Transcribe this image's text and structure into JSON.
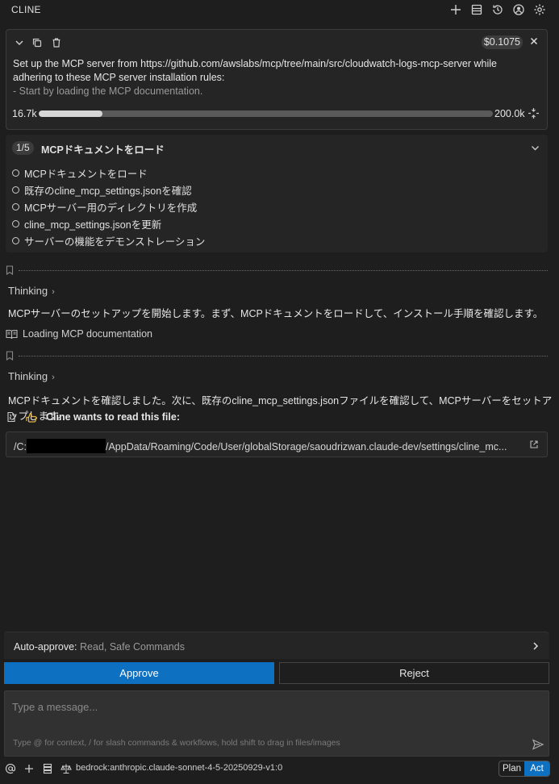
{
  "header": {
    "title": "CLINE"
  },
  "task": {
    "cost": "$0.1075",
    "text_line1": "Set up the MCP server from https://github.com/awslabs/mcp/tree/main/src/cloudwatch-logs-mcp-server while",
    "text_line2": "adhering to these MCP server installation rules:",
    "text_line3": "- Start by loading the MCP documentation.",
    "context_used": "16.7k",
    "context_max": "200.0k",
    "context_fraction": 0.14
  },
  "checklist": {
    "progress": "1/5",
    "current": "MCPドキュメントをロード",
    "items": [
      "MCPドキュメントをロード",
      "既存のcline_mcp_settings.jsonを確認",
      "MCPサーバー用のディレクトリを作成",
      "cline_mcp_settings.jsonを更新",
      "サーバーの機能をデモンストレーション"
    ]
  },
  "conversation": {
    "thinking_label": "Thinking",
    "message1": "MCPサーバーのセットアップを開始します。まず、MCPドキュメントをロードして、インストール手順を確認します。",
    "loading_label": "Loading MCP documentation",
    "message2": "MCPドキュメントを確認しました。次に、既存のcline_mcp_settings.jsonファイルを確認して、MCPサーバーをセットアップします。",
    "read_title": "Cline wants to read this file:",
    "path_prefix": "/C:",
    "path_suffix": "/AppData/Roaming/Code/User/globalStorage/saoudrizwan.claude-dev/settings/cline_mc..."
  },
  "auto_approve": {
    "label": "Auto-approve:",
    "value": "Read, Safe Commands"
  },
  "actions": {
    "approve": "Approve",
    "reject": "Reject"
  },
  "input": {
    "placeholder": "Type a message...",
    "hint": "Type @ for context, / for slash commands & workflows, hold shift to drag in files/images"
  },
  "footer": {
    "model": "bedrock:anthropic.claude-sonnet-4-5-20250929-v1:0",
    "plan": "Plan",
    "act": "Act"
  },
  "colors": {
    "background": "#1e1e1e",
    "card": "#252526",
    "accent": "#0e70c0"
  }
}
